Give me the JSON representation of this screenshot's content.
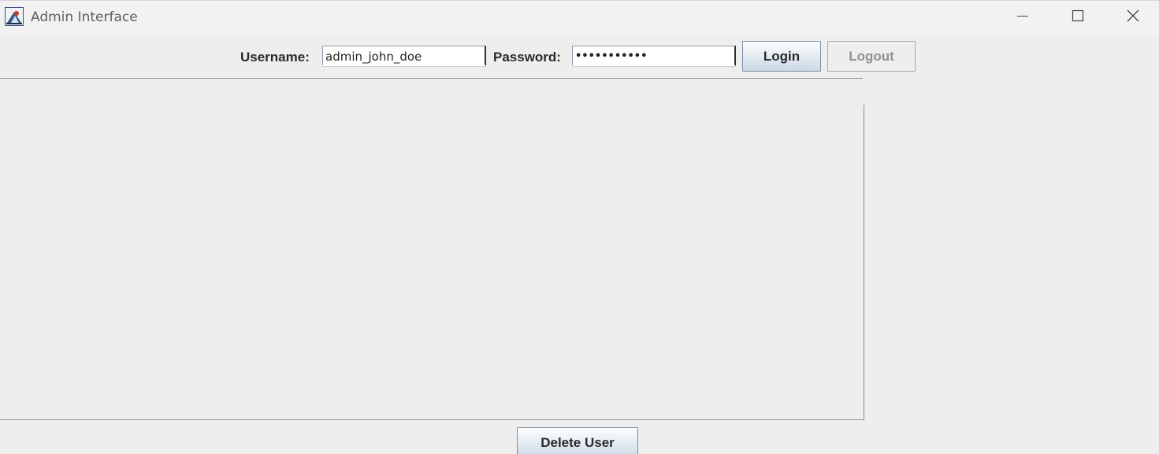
{
  "window": {
    "title": "Admin Interface",
    "icon": "java-coffee-icon",
    "controls": [
      "minimize-icon",
      "maximize-icon",
      "close-icon"
    ]
  },
  "login": {
    "username_label": "Username:",
    "username_value": "admin_john_doe",
    "password_label": "Password:",
    "password_value": "•••••••••••",
    "login_label": "Login",
    "logout_label": "Logout",
    "logout_enabled": false
  },
  "actions": {
    "delete_user_label": "Delete User"
  },
  "colors": {
    "background": "#eeeeee",
    "titlebar": "#f1f2f1",
    "button_border": "#7d8fa3",
    "disabled_text": "#909090"
  }
}
